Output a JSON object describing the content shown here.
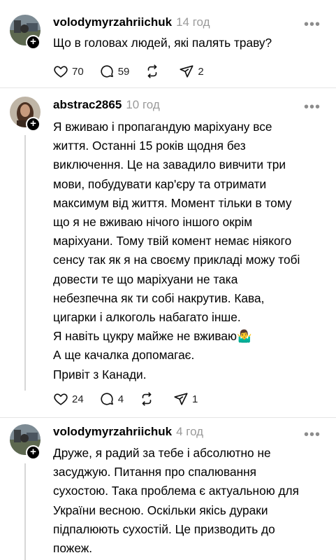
{
  "posts": [
    {
      "username": "volodymyrzahriichuk",
      "time": "14 год",
      "lines": [
        "Що в головах людей, які палять траву?"
      ],
      "likes": "70",
      "comments": "59",
      "reposts": "",
      "shares": "2"
    },
    {
      "username": "abstrac2865",
      "time": "10 год",
      "lines": [
        "Я вживаю і пропагандую маріхуану все",
        "життя. Останні 15 років щодня без",
        "виключення. Це на завадило вивчити три",
        "мови, побудувати кар'єру та отримати",
        "максимум від життя. Момент тільки в тому",
        "що я не вживаю нічого іншого окрім",
        "маріхуани. Тому твій комент немає ніякого",
        "сенсу так як я на своєму прикладі можу тобі",
        "довести те що маріхуани не така",
        "небезпечна як ти собі накрутив. Кава,",
        "цигарки і алкоголь набагато інше.",
        "Я навіть цукру майже не вживаю🤷‍♂️",
        "А ще качалка допомагає.",
        "Привіт з Канади."
      ],
      "likes": "24",
      "comments": "4",
      "reposts": "",
      "shares": "1"
    },
    {
      "username": "volodymyrzahriichuk",
      "time": "4 год",
      "lines": [
        "Друже, я радий за тебе і абсолютно не",
        "засуджую. Питання про спалювання",
        "сухостою. Така проблема є актуальною для",
        "України весною. Оскільки якісь дураки",
        "підпалюють сухостій. Це призводить до",
        "пожеж."
      ]
    }
  ],
  "icons": {
    "like": "heart-icon",
    "comment": "comment-bubble-icon",
    "repost": "repost-icon",
    "share": "share-plane-icon",
    "more": "more-dots-icon",
    "follow": "plus-icon"
  },
  "colors": {
    "background": "#ffffff",
    "text": "#000000",
    "muted": "#9a9a9a",
    "divider": "#e5e5e5",
    "thread_line": "#d7d7d7"
  }
}
